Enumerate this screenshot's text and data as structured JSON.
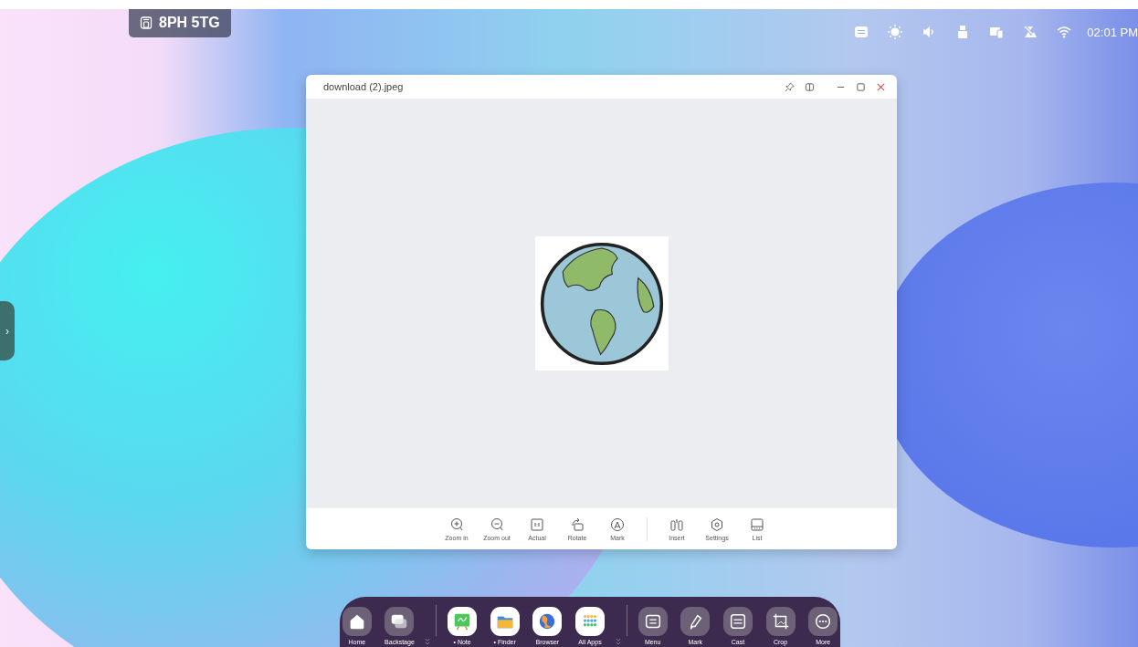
{
  "badge": {
    "code": "8PH 5TG"
  },
  "status_bar": {
    "time": "02:01 PM"
  },
  "side_handle": {
    "glyph": "›"
  },
  "window": {
    "title": "download (2).jpeg"
  },
  "toolbar": {
    "groups": [
      [
        {
          "label": "Zoom in"
        },
        {
          "label": "Zoom out"
        },
        {
          "label": "Actual"
        },
        {
          "label": "Rotate"
        },
        {
          "label": "Mark"
        }
      ],
      [
        {
          "label": "Insert"
        },
        {
          "label": "Settings"
        },
        {
          "label": "List"
        }
      ]
    ]
  },
  "dock": {
    "groups": [
      [
        {
          "label": "Home",
          "kind": "tool"
        },
        {
          "label": "Backstage",
          "kind": "tool"
        }
      ],
      [
        {
          "label": "• Note",
          "kind": "app"
        },
        {
          "label": "• Finder",
          "kind": "app"
        },
        {
          "label": "Browser",
          "kind": "app"
        },
        {
          "label": "All Apps",
          "kind": "app"
        }
      ],
      [
        {
          "label": "Menu",
          "kind": "tool"
        },
        {
          "label": "Mark",
          "kind": "tool"
        },
        {
          "label": "Cast",
          "kind": "tool"
        },
        {
          "label": "Crop",
          "kind": "tool"
        },
        {
          "label": "More",
          "kind": "tool"
        }
      ]
    ]
  }
}
